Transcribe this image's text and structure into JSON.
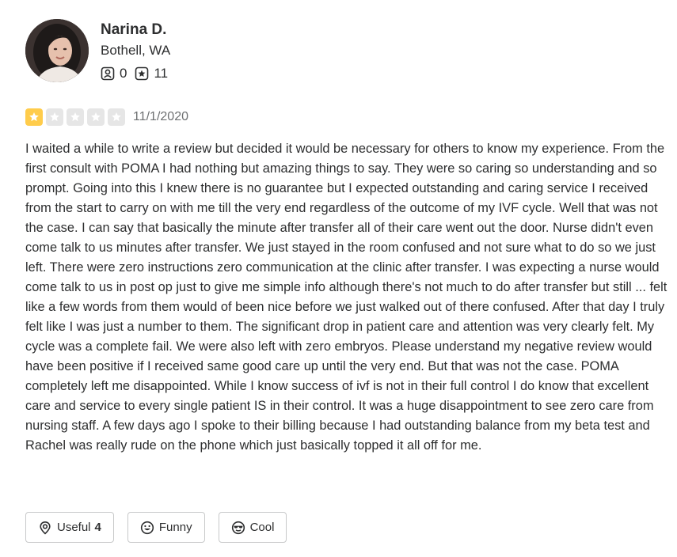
{
  "user": {
    "name": "Narina D.",
    "location": "Bothell, WA",
    "friends_count": "0",
    "reviews_count": "11"
  },
  "review": {
    "rating": 1,
    "max_rating": 5,
    "date": "11/1/2020",
    "text": "I waited a while to write a review but decided it would be necessary for others to know my experience. From the first consult with POMA I had nothing but amazing things to say. They were so caring so understanding and so prompt. Going into this I knew there is no guarantee but I expected outstanding and caring service I received from the start to carry on with me till the very end regardless of the outcome of my IVF cycle. Well that was not the case. I can say that basically the minute after transfer all of their care went out the door. Nurse didn't even come talk to us minutes after transfer. We just stayed in the room confused and not sure what to do so we just left. There were zero instructions zero communication at the clinic after transfer. I was expecting a nurse would come talk to us in post op just to give me simple info although there's not much to do after transfer but still ... felt like a few words from them would of been nice before we just walked out of there confused. After that day I truly felt like I was just a number to them. The significant drop in patient care and attention was very clearly felt. My cycle was a complete fail. We were also left with zero embryos. Please understand my negative review would have been positive if I received same good care up until the very end. But that was not the case. POMA completely left me disappointed. While I know success of ivf is not in their full control I do know that excellent care and service to every single patient IS in their control. It was a huge disappointment to see zero care from nursing staff. A few days ago I spoke to their billing because I had outstanding balance from my beta test and Rachel was really rude on the phone which just basically topped it all off for me."
  },
  "reactions": {
    "useful_label": "Useful",
    "useful_count": "4",
    "funny_label": "Funny",
    "cool_label": "Cool"
  },
  "colors": {
    "star_filled": "#ffcc4b",
    "star_empty": "#e6e6e6",
    "text": "#2d2e2f",
    "muted": "#6e7072",
    "border": "#c8c9ca"
  },
  "icons": {
    "friends": "friends-icon",
    "reviews": "review-star-icon",
    "useful": "useful-icon",
    "funny": "funny-icon",
    "cool": "cool-icon"
  }
}
